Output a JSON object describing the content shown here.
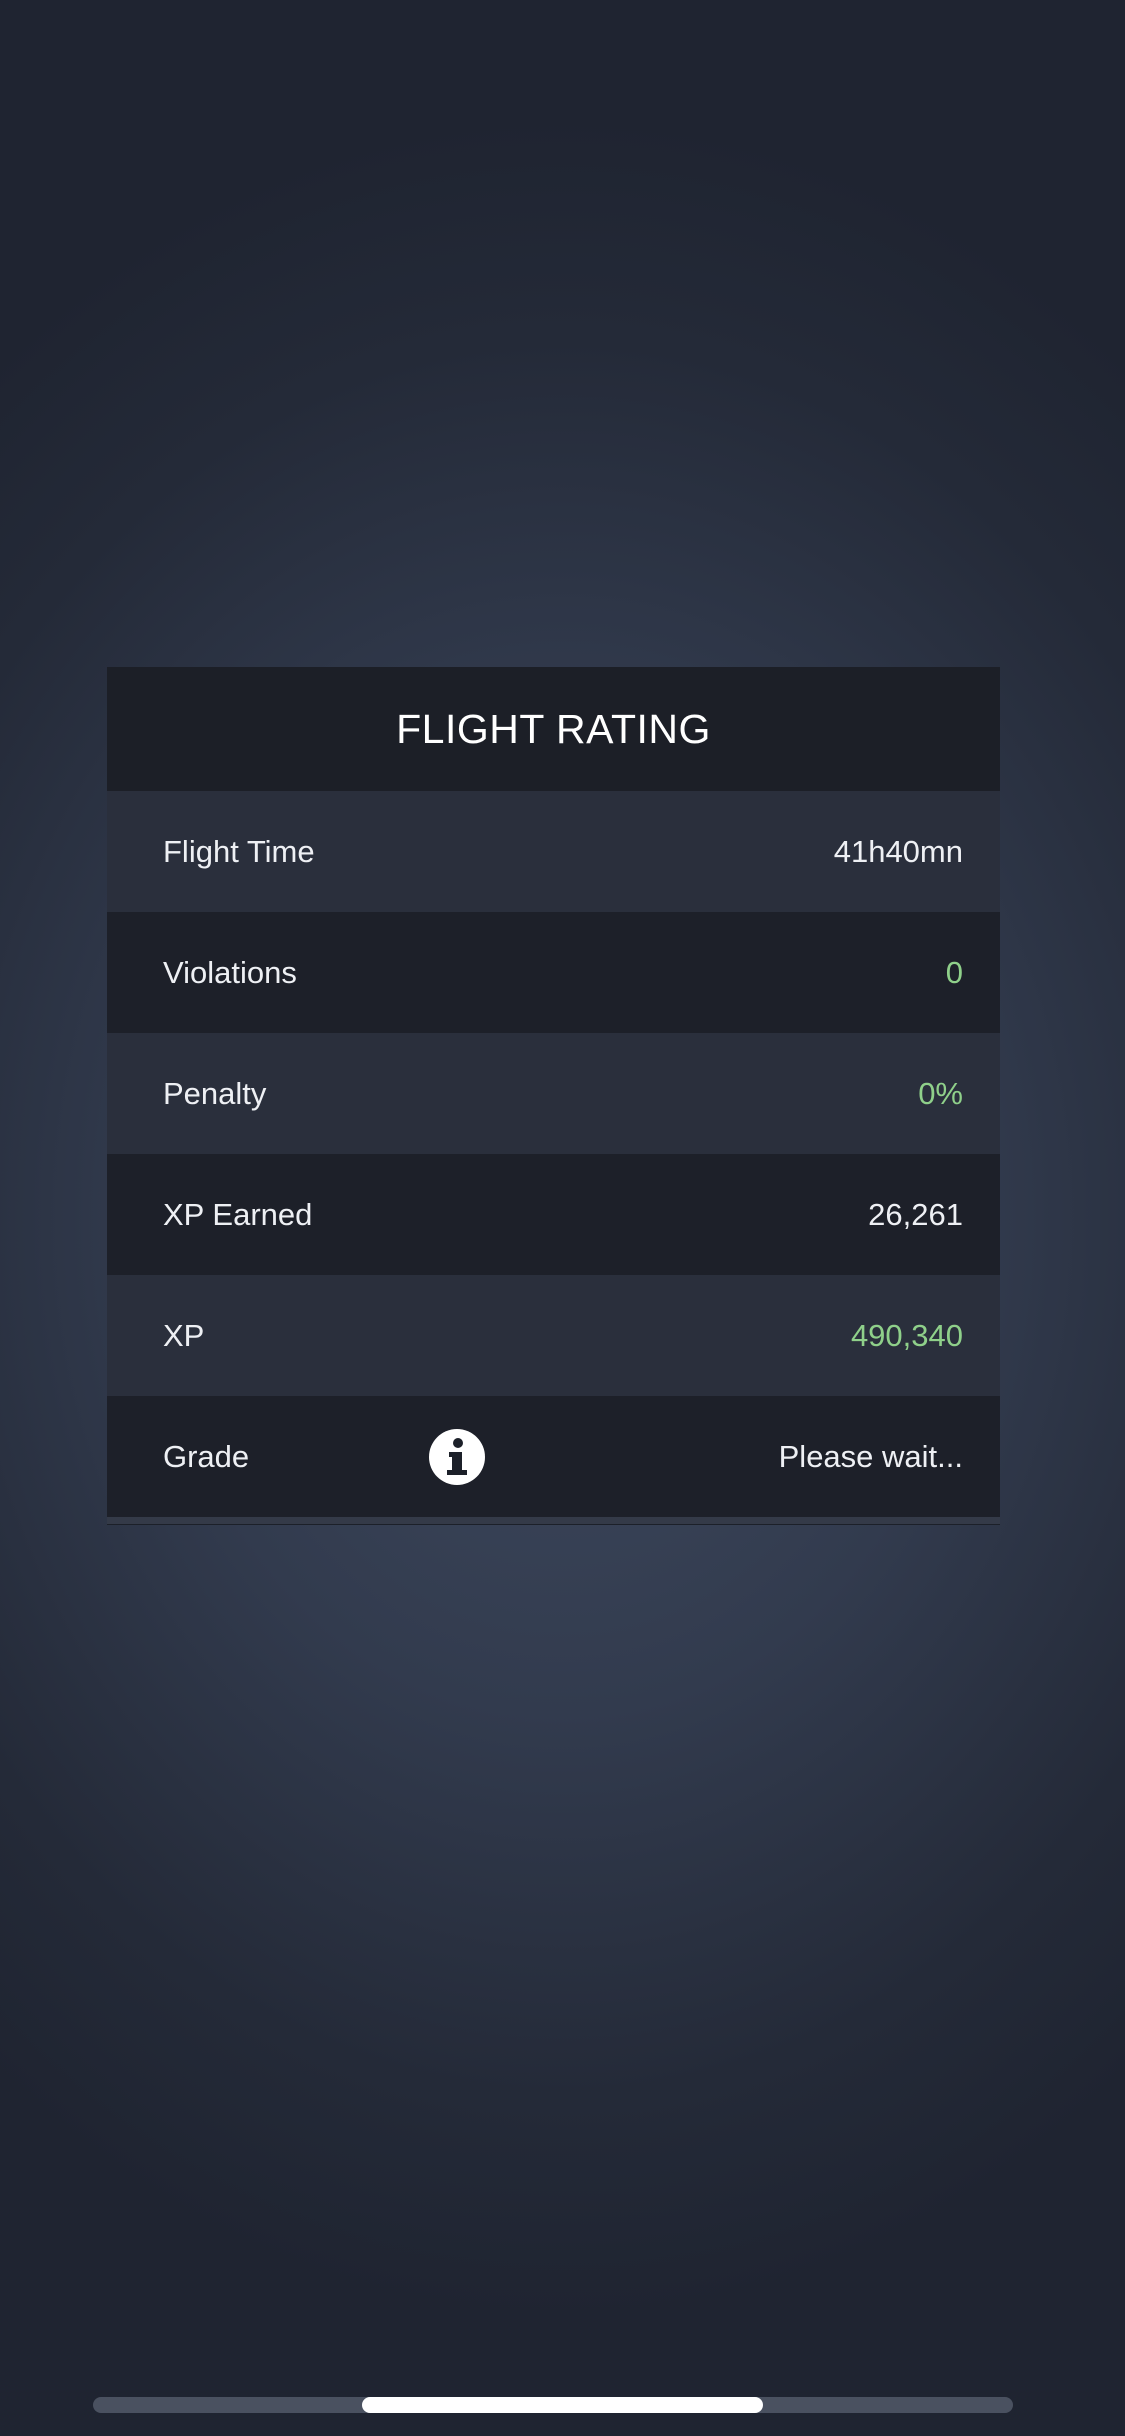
{
  "dialog": {
    "title": "FLIGHT RATING",
    "rows": [
      {
        "label": "Flight Time",
        "value": "41h40mn"
      },
      {
        "label": "Violations",
        "value": "0",
        "value_color": "#8fd08a"
      },
      {
        "label": "Penalty",
        "value": "0%",
        "value_color": "#8fd08a"
      },
      {
        "label": "XP Earned",
        "value": "26,261"
      },
      {
        "label": "XP",
        "value": "490,340",
        "value_color": "#8fd08a"
      },
      {
        "label": "Grade",
        "value": "Please wait...",
        "icon": "info-icon"
      }
    ]
  }
}
